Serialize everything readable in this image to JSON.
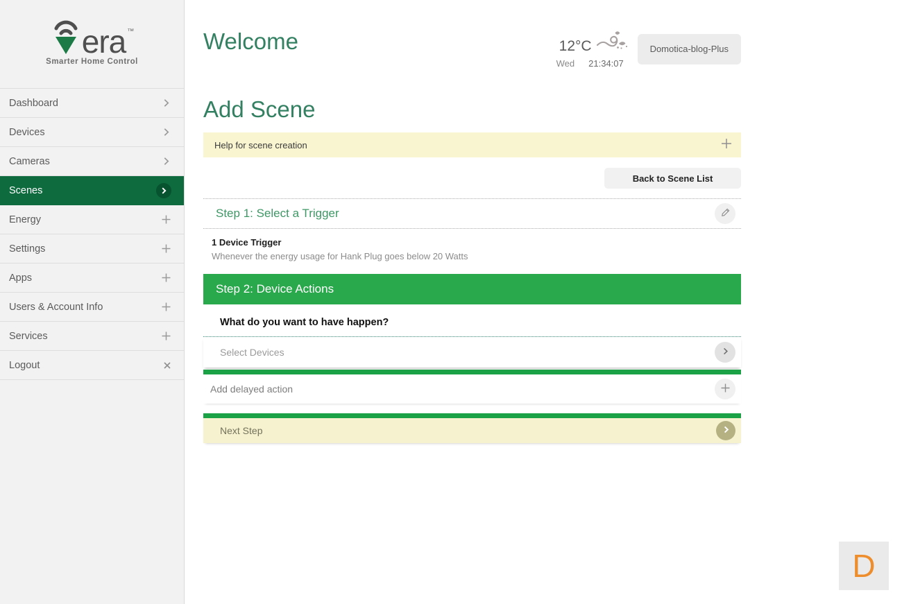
{
  "sidebar": {
    "logo": {
      "brand_full": "vera",
      "brand_suffix": "era",
      "tm": "™",
      "tagline": "Smarter Home Control"
    },
    "items": [
      {
        "label": "Dashboard",
        "icon": "chevron-right"
      },
      {
        "label": "Devices",
        "icon": "chevron-right"
      },
      {
        "label": "Cameras",
        "icon": "chevron-right"
      },
      {
        "label": "Scenes",
        "icon": "chevron-right-circle",
        "active": true
      },
      {
        "label": "Energy",
        "icon": "plus"
      },
      {
        "label": "Settings",
        "icon": "plus"
      },
      {
        "label": "Apps",
        "icon": "plus"
      },
      {
        "label": "Users & Account Info",
        "icon": "plus"
      },
      {
        "label": "Services",
        "icon": "plus"
      },
      {
        "label": "Logout",
        "icon": "close"
      }
    ]
  },
  "header": {
    "title": "Welcome",
    "weather": {
      "temperature": "12°C",
      "icon": "wind-swirl-icon"
    },
    "day": "Wed",
    "time": "21:34:07",
    "controller_button": "Domotica-blog-Plus"
  },
  "page": {
    "title": "Add Scene",
    "help_bar": {
      "label": "Help for scene creation",
      "icon": "plus"
    },
    "back_button": "Back to Scene List"
  },
  "step1": {
    "title": "Step 1: Select a Trigger",
    "edit_icon": "pencil",
    "trigger_count_label": "1 Device Trigger",
    "trigger_description": "Whenever the energy usage for Hank Plug goes below 20 Watts"
  },
  "step2": {
    "title": "Step 2: Device Actions",
    "question": "What do you want to have happen?",
    "select_devices_label": "Select Devices",
    "select_devices_icon": "chevron-right",
    "add_delayed_action_label": "Add delayed action",
    "add_delayed_action_icon": "plus"
  },
  "footer": {
    "next_step_label": "Next Step",
    "next_step_icon": "chevron-right"
  },
  "chat_widget": {
    "letter": "D"
  },
  "colors": {
    "sidebar_bg": "#f2f2f2",
    "active_item_green": "#0d6b3e",
    "active_circle_green": "#07522f",
    "heading_teal": "#338062",
    "step_title_green": "#3f9866",
    "step2_bar_green": "#2aa84c",
    "thick_bar_green": "#1ba246",
    "help_yellow": "#f9f5d1",
    "nextstep_yellow": "#f6f2cf",
    "olive_button": "#b6b183",
    "chat_letter_orange": "#ee8d2c",
    "logo_triangle_green": "#1b7a45"
  }
}
